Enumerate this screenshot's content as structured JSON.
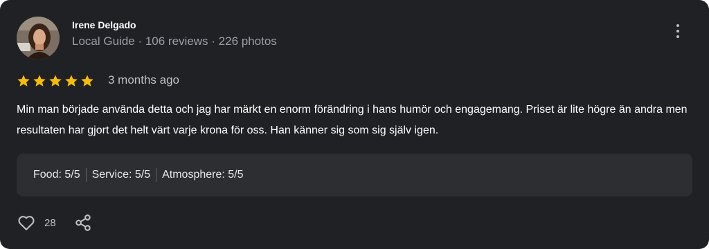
{
  "reviewer": {
    "name": "Irene Delgado",
    "meta": "Local Guide · 106 reviews · 226 photos"
  },
  "review": {
    "rating": 5,
    "max_rating": 5,
    "time": "3 months ago",
    "text": "Min man började använda detta och jag har märkt en enorm förändring i hans humör och engagemang. Priset är lite högre än andra men resultaten har gjort det helt värt varje krona för oss. Han känner sig som sig själv igen.",
    "star_color": "#fbbc04"
  },
  "ratings": [
    "Food: 5/5",
    "Service: 5/5",
    "Atmosphere: 5/5"
  ],
  "actions": {
    "like_count": "28",
    "like_icon": "heart-icon",
    "share_icon": "share-icon",
    "more_icon": "more-vertical-icon"
  }
}
